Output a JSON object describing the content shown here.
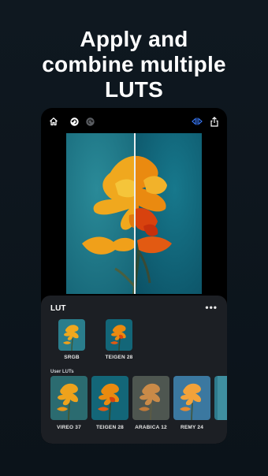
{
  "headline": {
    "line1": "Apply and",
    "line2": "combine multiple",
    "line3": "LUTS"
  },
  "toolbar": {
    "home_icon": "home-icon",
    "undo_icon": "undo-icon",
    "redo_icon": "redo-icon",
    "compare_icon": "compare-icon",
    "share_icon": "share-icon",
    "accent": "#3a7bff"
  },
  "panel": {
    "title": "LUT",
    "more": "•••",
    "applied": [
      {
        "label": "SRGB"
      },
      {
        "label": "TEIGEN 28"
      }
    ],
    "user_section": "User LUTs",
    "user_luts": [
      {
        "label": "VIREO 37"
      },
      {
        "label": "TEIGEN 28"
      },
      {
        "label": "ARABICA 12"
      },
      {
        "label": "REMY 24"
      }
    ]
  }
}
